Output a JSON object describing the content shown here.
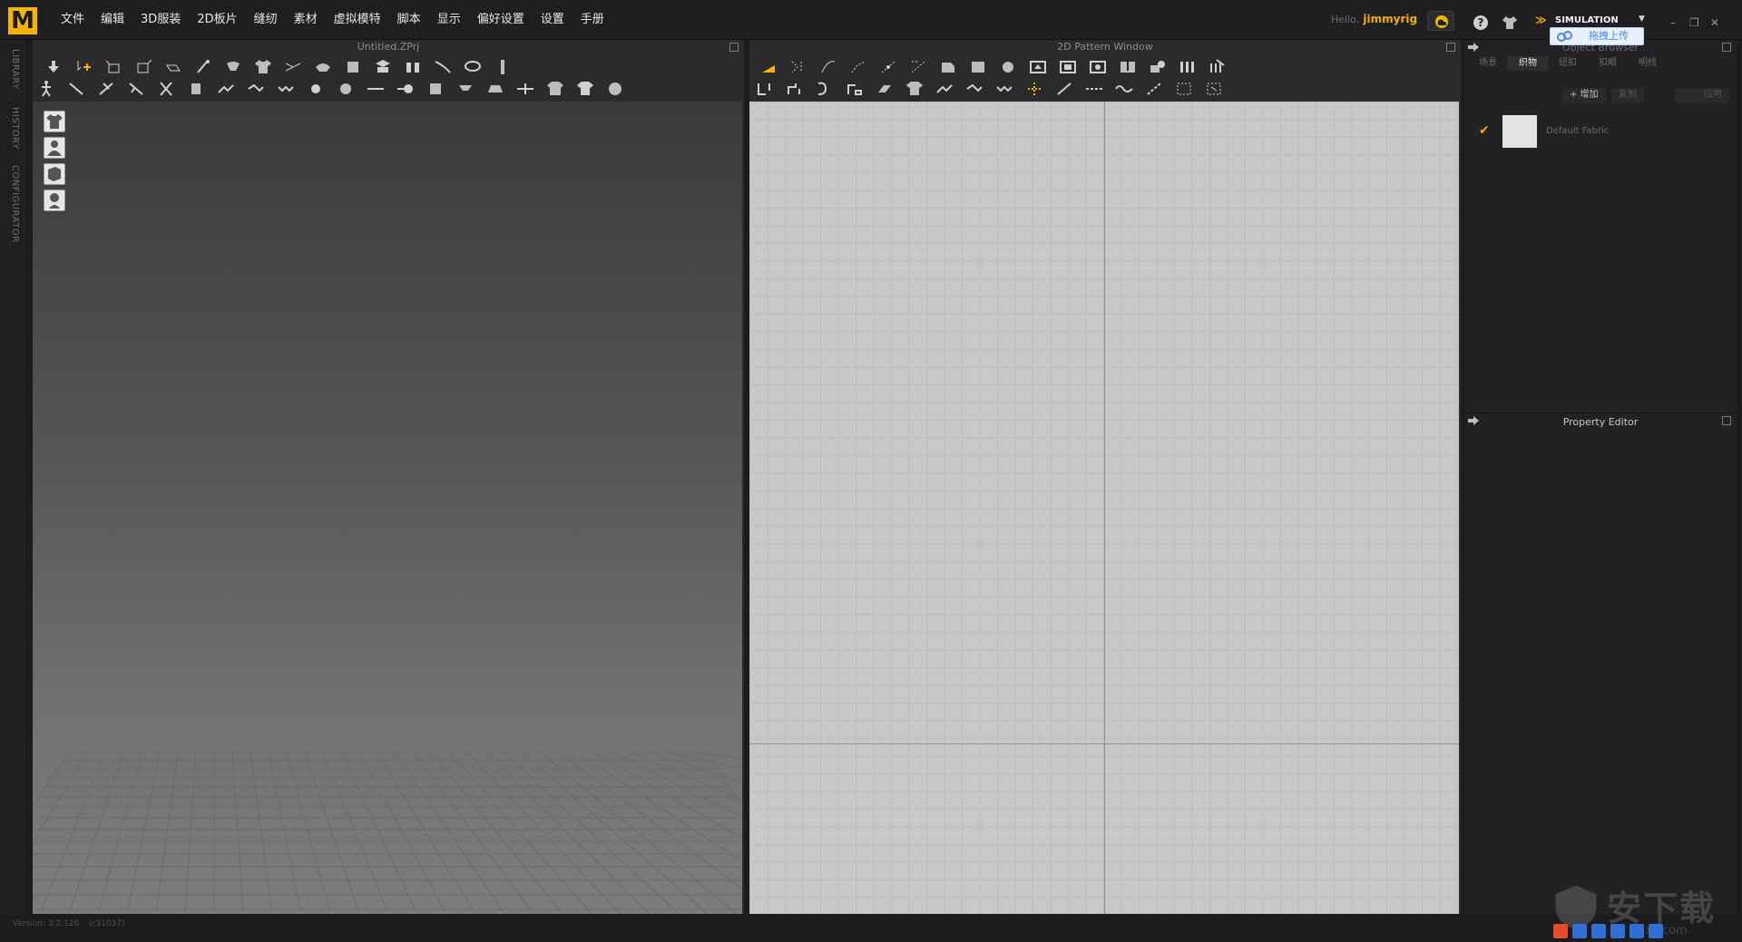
{
  "app": {
    "logo_letter": "M"
  },
  "menu": [
    "文件",
    "编辑",
    "3D服装",
    "2D板片",
    "缝纫",
    "素材",
    "虚拟模特",
    "脚本",
    "显示",
    "偏好设置",
    "设置",
    "手册"
  ],
  "user": {
    "hello": "Hello,",
    "name": "jimmyrig"
  },
  "mode": {
    "label": "SIMULATION"
  },
  "upload": {
    "label": "拖拽上传"
  },
  "side_tabs": [
    "LIBRARY",
    "HISTORY",
    "CONFIGURATOR"
  ],
  "view3d": {
    "title": "Untitled.ZPrj"
  },
  "view2d": {
    "title": "2D Pattern Window"
  },
  "object_browser": {
    "title": "Object Browser",
    "tabs": [
      "场景",
      "织物",
      "纽扣",
      "扣眼",
      "明线"
    ],
    "active_tab": "织物",
    "actions": {
      "add": "+ 增加",
      "copy": "复制",
      "apply": "应用"
    },
    "fabrics": [
      {
        "name": "Default Fabric",
        "checked": true,
        "swatch_color": "#e3e3e3"
      }
    ]
  },
  "property_editor": {
    "title": "Property Editor"
  },
  "status": {
    "version": "Version: 3.2.126",
    "build": "(r31037)"
  },
  "watermark": {
    "text": "安下载",
    "domain": "anxz.com"
  },
  "colors": {
    "accent": "#f4b400",
    "pattern_bg": "#c8c8c8"
  },
  "icons": {
    "avatar_buttons": [
      "shirt-icon",
      "avatar-body-icon",
      "garment-show-icon",
      "avatar-head-icon"
    ],
    "window_controls": [
      "minimize-icon",
      "restore-icon",
      "close-icon"
    ]
  }
}
